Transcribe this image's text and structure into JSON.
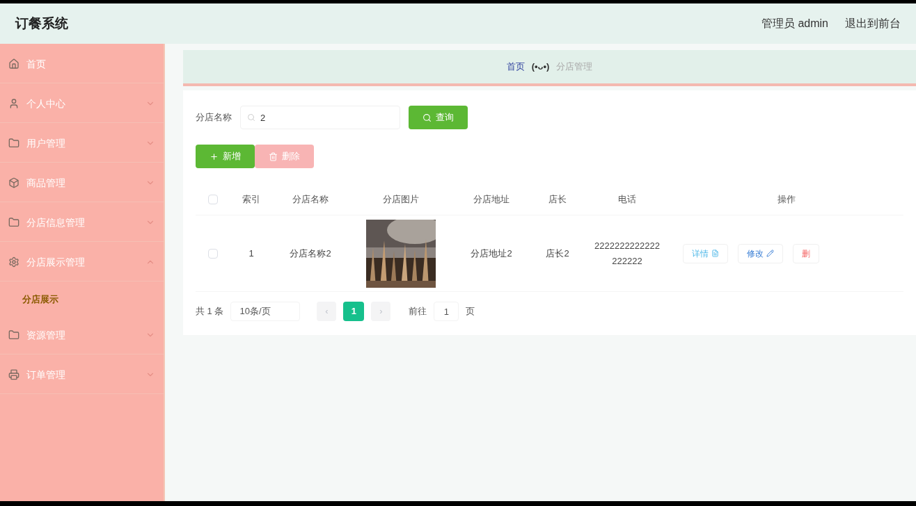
{
  "header": {
    "title": "订餐系统",
    "user": "管理员 admin",
    "exit": "退出到前台"
  },
  "sidebar": {
    "items": [
      {
        "label": "首页"
      },
      {
        "label": "个人中心",
        "expanded": false
      },
      {
        "label": "用户管理",
        "expanded": false
      },
      {
        "label": "商品管理",
        "expanded": false
      },
      {
        "label": "分店信息管理",
        "expanded": false
      },
      {
        "label": "分店展示管理",
        "expanded": true,
        "children": [
          {
            "label": "分店展示",
            "selected": true
          }
        ]
      },
      {
        "label": "资源管理",
        "expanded": false
      },
      {
        "label": "订单管理",
        "expanded": false
      }
    ]
  },
  "breadcrumb": {
    "home": "首页",
    "face": "(•ᴗ•)",
    "current": "分店管理"
  },
  "search": {
    "label": "分店名称",
    "value": "2",
    "button": "查询"
  },
  "actions": {
    "add": "新增",
    "delete": "删除",
    "delete_disabled": true
  },
  "table": {
    "columns": [
      "索引",
      "分店名称",
      "分店图片",
      "分店地址",
      "店长",
      "电话",
      "操作"
    ],
    "header_checked": false,
    "rows": [
      {
        "checked": false,
        "cells": [
          "1",
          "分店名称2",
          {
            "kind": "picture"
          },
          "分店地址2",
          "店长2",
          "2222222222222222222"
        ],
        "ops": [
          "详情",
          "修改",
          "删"
        ]
      }
    ]
  },
  "pagination": {
    "total": "共 1 条",
    "page_size": "10条/页",
    "prev": "‹",
    "pages": [
      {
        "label": "1",
        "selected": true
      }
    ],
    "next": "›",
    "goto": "前往",
    "goto_value": "1",
    "page_unit": "页"
  }
}
